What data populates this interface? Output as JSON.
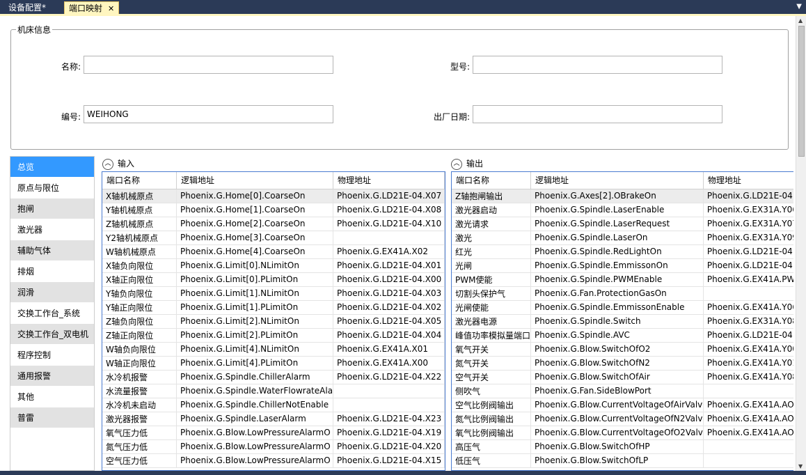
{
  "tabs": [
    {
      "label": "设备配置*"
    },
    {
      "label": "端口映射",
      "close": "✕"
    }
  ],
  "machine_info": {
    "legend": "机床信息",
    "name_label": "名称:",
    "name_value": "",
    "model_label": "型号:",
    "model_value": "",
    "serial_label": "编号:",
    "serial_value": "WEIHONG",
    "date_label": "出厂日期:",
    "date_value": ""
  },
  "nav": {
    "items": [
      {
        "label": "总览"
      },
      {
        "label": "原点与限位"
      },
      {
        "label": "抱闸"
      },
      {
        "label": "激光器"
      },
      {
        "label": "辅助气体"
      },
      {
        "label": "排烟"
      },
      {
        "label": "润滑"
      },
      {
        "label": "交换工作台_系统"
      },
      {
        "label": "交换工作台_双电机"
      },
      {
        "label": "程序控制"
      },
      {
        "label": "通用报警"
      },
      {
        "label": "其他"
      },
      {
        "label": "普雷"
      }
    ]
  },
  "input": {
    "title": "输入",
    "columns": [
      "端口名称",
      "逻辑地址",
      "物理地址"
    ],
    "rows": [
      [
        "X轴机械原点",
        "Phoenix.G.Home[0].CoarseOn",
        "Phoenix.G.LD21E-04.X07"
      ],
      [
        "Y轴机械原点",
        "Phoenix.G.Home[1].CoarseOn",
        "Phoenix.G.LD21E-04.X08"
      ],
      [
        "Z轴机械原点",
        "Phoenix.G.Home[2].CoarseOn",
        "Phoenix.G.LD21E-04.X10"
      ],
      [
        "Y2轴机械原点",
        "Phoenix.G.Home[3].CoarseOn",
        ""
      ],
      [
        "W轴机械原点",
        "Phoenix.G.Home[4].CoarseOn",
        "Phoenix.G.EX41A.X02"
      ],
      [
        "X轴负向限位",
        "Phoenix.G.Limit[0].NLimitOn",
        "Phoenix.G.LD21E-04.X01"
      ],
      [
        "X轴正向限位",
        "Phoenix.G.Limit[0].PLimitOn",
        "Phoenix.G.LD21E-04.X00"
      ],
      [
        "Y轴负向限位",
        "Phoenix.G.Limit[1].NLimitOn",
        "Phoenix.G.LD21E-04.X03"
      ],
      [
        "Y轴正向限位",
        "Phoenix.G.Limit[1].PLimitOn",
        "Phoenix.G.LD21E-04.X02"
      ],
      [
        "Z轴负向限位",
        "Phoenix.G.Limit[2].NLimitOn",
        "Phoenix.G.LD21E-04.X05"
      ],
      [
        "Z轴正向限位",
        "Phoenix.G.Limit[2].PLimitOn",
        "Phoenix.G.LD21E-04.X04"
      ],
      [
        "W轴负向限位",
        "Phoenix.G.Limit[4].NLimitOn",
        "Phoenix.G.EX41A.X01"
      ],
      [
        "W轴正向限位",
        "Phoenix.G.Limit[4].PLimitOn",
        "Phoenix.G.EX41A.X00"
      ],
      [
        "水冷机报警",
        "Phoenix.G.Spindle.ChillerAlarm",
        "Phoenix.G.LD21E-04.X22"
      ],
      [
        "水流量报警",
        "Phoenix.G.Spindle.WaterFlowrateAla",
        ""
      ],
      [
        "水冷机未启动",
        "Phoenix.G.Spindle.ChillerNotEnable",
        ""
      ],
      [
        "激光器报警",
        "Phoenix.G.Spindle.LaserAlarm",
        "Phoenix.G.LD21E-04.X23"
      ],
      [
        "氧气压力低",
        "Phoenix.G.Blow.LowPressureAlarmO",
        "Phoenix.G.LD21E-04.X19"
      ],
      [
        "氮气压力低",
        "Phoenix.G.Blow.LowPressureAlarmO",
        "Phoenix.G.LD21E-04.X20"
      ],
      [
        "空气压力低",
        "Phoenix.G.Blow.LowPressureAlarmO",
        "Phoenix.G.LD21E-04.X15"
      ]
    ]
  },
  "output": {
    "title": "输出",
    "columns": [
      "端口名称",
      "逻辑地址",
      "物理地址"
    ],
    "rows": [
      [
        "Z轴抱闸输出",
        "Phoenix.G.Axes[2].OBrakeOn",
        "Phoenix.G.LD21E-04.Y0"
      ],
      [
        "激光器启动",
        "Phoenix.G.Spindle.LaserEnable",
        "Phoenix.G.EX31A.Y06"
      ],
      [
        "激光请求",
        "Phoenix.G.Spindle.LaserRequest",
        "Phoenix.G.EX31A.Y07"
      ],
      [
        "激光",
        "Phoenix.G.Spindle.LaserOn",
        "Phoenix.G.EX31A.Y09"
      ],
      [
        "红光",
        "Phoenix.G.Spindle.RedLightOn",
        "Phoenix.G.LD21E-04.Y0"
      ],
      [
        "光闸",
        "Phoenix.G.Spindle.EmmissonOn",
        "Phoenix.G.LD21E-04.Y0"
      ],
      [
        "PWM使能",
        "Phoenix.G.Spindle.PWMEnable",
        "Phoenix.G.EX41A.PWM"
      ],
      [
        "切割头保护气",
        "Phoenix.G.Fan.ProtectionGasOn",
        ""
      ],
      [
        "光闸使能",
        "Phoenix.G.Spindle.EmmissonEnable",
        "Phoenix.G.EX41A.Y06"
      ],
      [
        "激光器电源",
        "Phoenix.G.Spindle.Switch",
        "Phoenix.G.EX31A.Y08"
      ],
      [
        "峰值功率模拟量端口",
        "Phoenix.G.Spindle.AVC",
        "Phoenix.G.LD21E-04.A"
      ],
      [
        "氧气开关",
        "Phoenix.G.Blow.SwitchOfO2",
        "Phoenix.G.EX41A.Y00"
      ],
      [
        "氮气开关",
        "Phoenix.G.Blow.SwitchOfN2",
        "Phoenix.G.EX41A.Y01"
      ],
      [
        "空气开关",
        "Phoenix.G.Blow.SwitchOfAir",
        "Phoenix.G.EX41A.Y08"
      ],
      [
        "侧吹气",
        "Phoenix.G.Fan.SideBlowPort",
        ""
      ],
      [
        "空气比例阀输出",
        "Phoenix.G.Blow.CurrentVoltageOfAirValv",
        "Phoenix.G.EX41A.AOut"
      ],
      [
        "氮气比例阀输出",
        "Phoenix.G.Blow.CurrentVoltageOfN2Valv",
        "Phoenix.G.EX41A.AOut"
      ],
      [
        "氧气比例阀输出",
        "Phoenix.G.Blow.CurrentVoltageOfO2Valv",
        "Phoenix.G.EX41A.AOut"
      ],
      [
        "高压气",
        "Phoenix.G.Blow.SwitchOfHP",
        ""
      ],
      [
        "低压气",
        "Phoenix.G.Blow.SwitchOfLP",
        ""
      ]
    ]
  }
}
